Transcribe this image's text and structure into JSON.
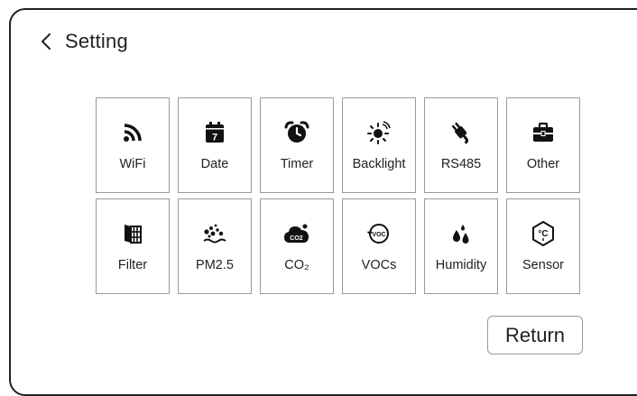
{
  "header": {
    "title": "Setting"
  },
  "tiles": [
    {
      "label": "WiFi",
      "icon": "wifi-icon"
    },
    {
      "label": "Date",
      "icon": "calendar-icon",
      "icon_text": "7"
    },
    {
      "label": "Timer",
      "icon": "alarm-clock-icon"
    },
    {
      "label": "Backlight",
      "icon": "backlight-icon"
    },
    {
      "label": "RS485",
      "icon": "plug-icon"
    },
    {
      "label": "Other",
      "icon": "briefcase-icon"
    },
    {
      "label": "Filter",
      "icon": "filter-icon"
    },
    {
      "label": "PM2.5",
      "icon": "particles-icon"
    },
    {
      "label": "CO₂",
      "icon": "co2-cloud-icon",
      "icon_text": "CO2"
    },
    {
      "label": "VOCs",
      "icon": "voc-icon",
      "icon_text": "VOC"
    },
    {
      "label": "Humidity",
      "icon": "water-drops-icon"
    },
    {
      "label": "Sensor",
      "icon": "sensor-icon",
      "icon_text": "°C"
    }
  ],
  "footer": {
    "return_label": "Return"
  },
  "colors": {
    "text": "#222222",
    "border": "#9a9a9a",
    "frame": "#222222",
    "background": "#ffffff"
  }
}
